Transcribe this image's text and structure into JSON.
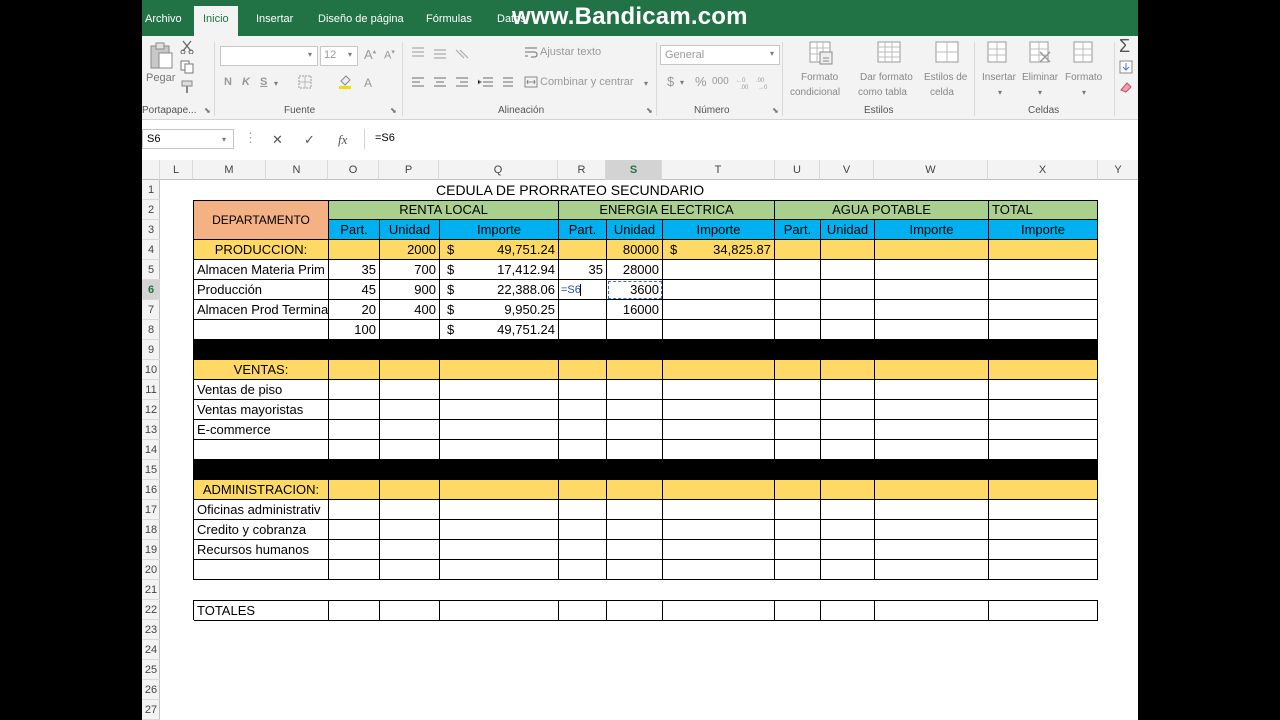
{
  "ribbon": {
    "tabs": [
      "Archivo",
      "Inicio",
      "Insertar",
      "Diseño de página",
      "Fórmulas",
      "Datos"
    ],
    "watermark": "www.Bandicam.com",
    "paste_label": "Pegar",
    "clipboard_group": "Portapape...",
    "font_group": "Fuente",
    "font_size": "12",
    "bold_label": "N",
    "italic_label": "K",
    "underline_label": "S",
    "alignment_group": "Alineación",
    "wrap_text": "Ajustar texto",
    "merge_center": "Combinar y centrar",
    "number_format": "General",
    "currency_symbol": "$",
    "percent_symbol": "%",
    "thousands_label": "000",
    "number_group": "Número",
    "conditional_format_1": "Formato",
    "conditional_format_2": "condicional",
    "format_table_1": "Dar formato",
    "format_table_2": "como tabla",
    "cell_styles_1": "Estilos de",
    "cell_styles_2": "celda",
    "styles_group": "Estilos",
    "insert_label": "Insertar",
    "delete_label": "Eliminar",
    "format_label": "Formato",
    "cells_group": "Celdas"
  },
  "formula_bar": {
    "name_box": "S6",
    "cancel": "✕",
    "enter": "✓",
    "fx": "fx",
    "formula": "=S6"
  },
  "columns": [
    "L",
    "M",
    "N",
    "O",
    "P",
    "Q",
    "R",
    "S",
    "T",
    "U",
    "V",
    "W",
    "X",
    "Y"
  ],
  "rows": [
    "1",
    "2",
    "3",
    "4",
    "5",
    "6",
    "7",
    "8",
    "9",
    "10",
    "11",
    "12",
    "13",
    "14",
    "15",
    "16",
    "17",
    "18",
    "19",
    "20",
    "21",
    "22",
    "23",
    "24",
    "25",
    "26",
    "27"
  ],
  "colors": {
    "excel_green": "#217346",
    "header_green": "#a9d08e",
    "header_blue": "#00b0f0",
    "header_orange": "#f4b183",
    "band_yellow": "#ffd966",
    "black_band": "#000000"
  },
  "sheet": {
    "title": "CEDULA DE PRORRATEO SECUNDARIO",
    "departamento": "DEPARTAMENTO",
    "renta_local": "RENTA LOCAL",
    "energia_electrica": "ENERGIA ELECTRICA",
    "agua_potable": "AGUA POTABLE",
    "total": "TOTAL",
    "part": "Part.",
    "unidad": "Unidad",
    "importe": "Importe",
    "produccion_header": "PRODUCCION:",
    "r4": {
      "p": "2000",
      "q_sym": "$",
      "q": "49,751.24",
      "s": "80000",
      "t_sym": "$",
      "t": "34,825.87"
    },
    "r5": {
      "m": "Almacen Materia Prim",
      "o": "35",
      "p": "700",
      "q_sym": "$",
      "q": "17,412.94",
      "r": "35",
      "s": "28000"
    },
    "r6": {
      "m": "Producción",
      "o": "45",
      "p": "900",
      "q_sym": "$",
      "q": "22,388.06",
      "r": "=S6",
      "s": "3600"
    },
    "r7": {
      "m": "Almacen Prod Termina",
      "o": "20",
      "p": "400",
      "q_sym": "$",
      "q": "9,950.25",
      "s": "16000"
    },
    "r8": {
      "o": "100",
      "q_sym": "$",
      "q": "49,751.24"
    },
    "ventas_header": "VENTAS:",
    "ventas_items": [
      "Ventas de piso",
      "Ventas mayoristas",
      "E-commerce"
    ],
    "admin_header": "ADMINISTRACION:",
    "admin_items": [
      "Oficinas administrativ",
      "Credito y cobranza",
      "Recursos humanos"
    ],
    "totales": "TOTALES"
  }
}
